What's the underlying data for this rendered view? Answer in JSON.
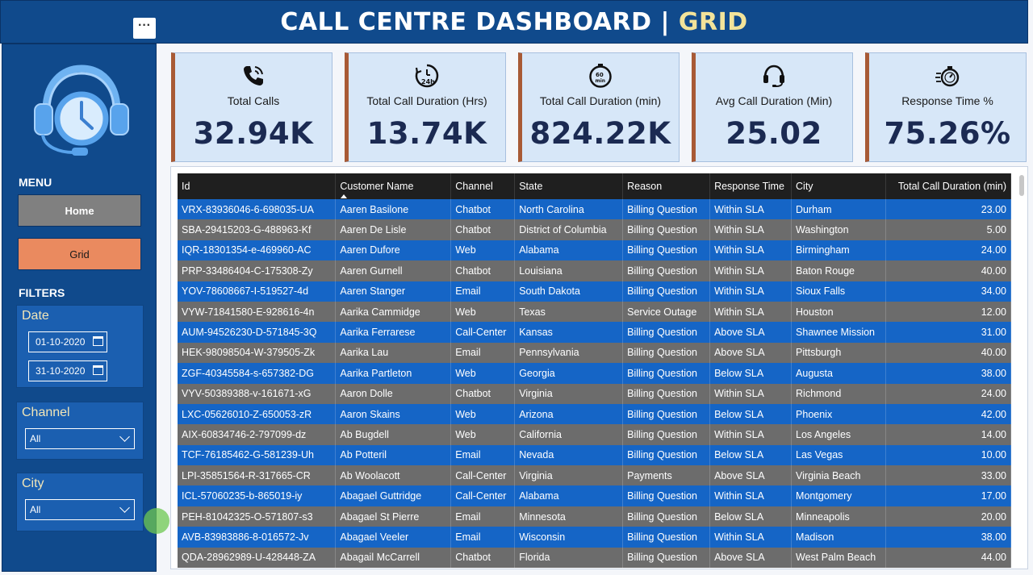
{
  "header": {
    "title": "CALL CENTRE DASHBOARD",
    "separator": " | ",
    "subtitle": "GRID",
    "more_label": "···"
  },
  "sidebar": {
    "menu_title": "MENU",
    "nav": {
      "home": "Home",
      "grid": "Grid"
    },
    "filters_title": "FILTERS",
    "date": {
      "label": "Date",
      "start": "01-10-2020",
      "end": "31-10-2020"
    },
    "channel": {
      "label": "Channel",
      "value": "All"
    },
    "city": {
      "label": "City",
      "value": "All"
    }
  },
  "kpis": [
    {
      "icon": "phone-icon",
      "label": "Total Calls",
      "value": "32.94K"
    },
    {
      "icon": "clock-24h-icon",
      "label": "Total Call Duration (Hrs)",
      "value": "13.74K"
    },
    {
      "icon": "timer-60min-icon",
      "label": "Total Call Duration (min)",
      "value": "824.22K"
    },
    {
      "icon": "headset-icon",
      "label": "Avg Call Duration (Min)",
      "value": "25.02"
    },
    {
      "icon": "stopwatch-fast-icon",
      "label": "Response Time %",
      "value": "75.26%"
    }
  ],
  "table": {
    "columns": [
      "Id",
      "Customer Name",
      "Channel",
      "State",
      "Reason",
      "Response Time",
      "City",
      "Total Call Duration (min)"
    ],
    "rows": [
      [
        "VRX-83936046-6-698035-UA",
        "Aaren Basilone",
        "Chatbot",
        "North Carolina",
        "Billing Question",
        "Within SLA",
        "Durham",
        "23.00"
      ],
      [
        "SBA-29415203-G-488963-Kf",
        "Aaren De Lisle",
        "Chatbot",
        "District of Columbia",
        "Billing Question",
        "Within SLA",
        "Washington",
        "5.00"
      ],
      [
        "IQR-18301354-e-469960-AC",
        "Aaren Dufore",
        "Web",
        "Alabama",
        "Billing Question",
        "Within SLA",
        "Birmingham",
        "24.00"
      ],
      [
        "PRP-33486404-C-175308-Zy",
        "Aaren Gurnell",
        "Chatbot",
        "Louisiana",
        "Billing Question",
        "Within SLA",
        "Baton Rouge",
        "40.00"
      ],
      [
        "YOV-78608667-I-519527-4d",
        "Aaren Stanger",
        "Email",
        "South Dakota",
        "Billing Question",
        "Within SLA",
        "Sioux Falls",
        "34.00"
      ],
      [
        "VYW-71841580-E-928616-4n",
        "Aarika Cammidge",
        "Web",
        "Texas",
        "Service Outage",
        "Within SLA",
        "Houston",
        "12.00"
      ],
      [
        "AUM-94526230-D-571845-3Q",
        "Aarika Ferrarese",
        "Call-Center",
        "Kansas",
        "Billing Question",
        "Above SLA",
        "Shawnee Mission",
        "31.00"
      ],
      [
        "HEK-98098504-W-379505-Zk",
        "Aarika Lau",
        "Email",
        "Pennsylvania",
        "Billing Question",
        "Above SLA",
        "Pittsburgh",
        "40.00"
      ],
      [
        "ZGF-40345584-s-657382-DG",
        "Aarika Partleton",
        "Web",
        "Georgia",
        "Billing Question",
        "Below SLA",
        "Augusta",
        "38.00"
      ],
      [
        "VYV-50389388-v-161671-xG",
        "Aaron Dolle",
        "Chatbot",
        "Virginia",
        "Billing Question",
        "Within SLA",
        "Richmond",
        "24.00"
      ],
      [
        "LXC-05626010-Z-650053-zR",
        "Aaron Skains",
        "Web",
        "Arizona",
        "Billing Question",
        "Below SLA",
        "Phoenix",
        "42.00"
      ],
      [
        "AIX-60834746-2-797099-dz",
        "Ab Bugdell",
        "Web",
        "California",
        "Billing Question",
        "Within SLA",
        "Los Angeles",
        "14.00"
      ],
      [
        "TCF-76185462-G-581239-Uh",
        "Ab Potteril",
        "Email",
        "Nevada",
        "Billing Question",
        "Below SLA",
        "Las Vegas",
        "10.00"
      ],
      [
        "LPI-35851564-R-317665-CR",
        "Ab Woolacott",
        "Call-Center",
        "Virginia",
        "Payments",
        "Above SLA",
        "Virginia Beach",
        "33.00"
      ],
      [
        "ICL-57060235-b-865019-iy",
        "Abagael Guttridge",
        "Call-Center",
        "Alabama",
        "Billing Question",
        "Within SLA",
        "Montgomery",
        "17.00"
      ],
      [
        "PEH-81042325-O-571807-s3",
        "Abagael St Pierre",
        "Email",
        "Minnesota",
        "Billing Question",
        "Below SLA",
        "Minneapolis",
        "20.00"
      ],
      [
        "AVB-83983886-8-016572-Jv",
        "Abagael Veeler",
        "Email",
        "Wisconsin",
        "Billing Question",
        "Within SLA",
        "Madison",
        "38.00"
      ],
      [
        "QDA-28962989-U-428448-ZA",
        "Abagail McCarrell",
        "Chatbot",
        "Florida",
        "Billing Question",
        "Above SLA",
        "West Palm Beach",
        "44.00"
      ]
    ]
  },
  "colors": {
    "header_bg": "#104a8c",
    "accent_yellow": "#f2e39a",
    "grid_button": "#ea8a5f",
    "row_blue": "#1565c6",
    "row_gray": "#6c6c6c",
    "kpi_border": "#a85a35"
  }
}
